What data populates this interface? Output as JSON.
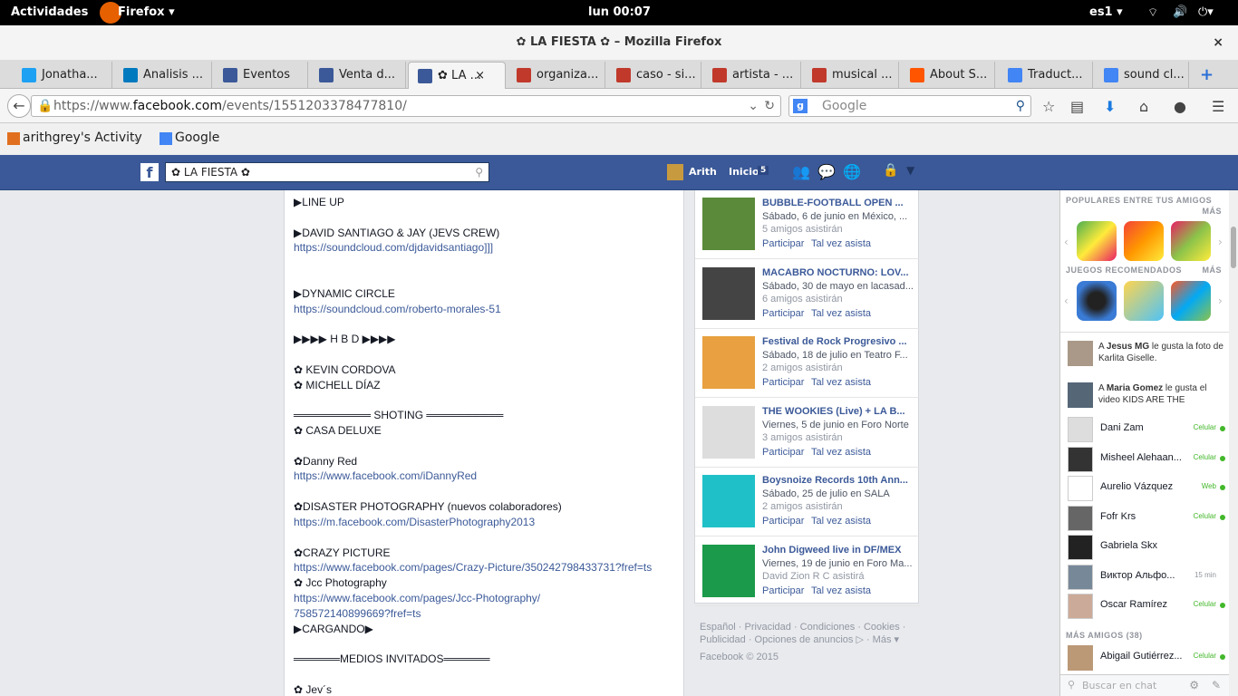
{
  "gnome": {
    "activities": "Actividades",
    "app": "Firefox ▾",
    "clock": "lun 00:07",
    "lang": "es1 ▾"
  },
  "window": {
    "title": "✿ LA FIESTA ✿ – Mozilla Firefox",
    "close": "×"
  },
  "tabs": [
    {
      "label": "Jonatha...",
      "icon": "twitter-icon",
      "color": "#1da1f2"
    },
    {
      "label": "Analisis ...",
      "icon": "trello-icon",
      "color": "#0079bf"
    },
    {
      "label": "Eventos",
      "icon": "facebook-icon",
      "color": "#3b5998"
    },
    {
      "label": "Venta d...",
      "icon": "facebook-icon",
      "color": "#3b5998"
    },
    {
      "label": "✿ LA ...",
      "icon": "facebook-icon",
      "color": "#3b5998"
    },
    {
      "label": "organiza...",
      "icon": "wordreference-icon",
      "color": "#c0392b"
    },
    {
      "label": "caso - si...",
      "icon": "wordreference-icon",
      "color": "#c0392b"
    },
    {
      "label": "artista - ...",
      "icon": "wordreference-icon",
      "color": "#c0392b"
    },
    {
      "label": "musical ...",
      "icon": "wordreference-icon",
      "color": "#c0392b"
    },
    {
      "label": "About S...",
      "icon": "soundcloud-icon",
      "color": "#ff5500"
    },
    {
      "label": "Traduct...",
      "icon": "translate-icon",
      "color": "#4285f4"
    },
    {
      "label": "sound cl...",
      "icon": "google-icon",
      "color": "#4285f4"
    }
  ],
  "nav": {
    "url_prefix": "https://www.",
    "url_domain": "facebook.com",
    "url_path": "/events/1551203378477810/",
    "search_placeholder": "Google"
  },
  "bookmarks": [
    {
      "label": "arithgrey's Activity"
    },
    {
      "label": "Google"
    }
  ],
  "fb": {
    "search_value": "✿ LA FIESTA ✿",
    "user": "Arith",
    "home": "Inicio",
    "home_count": "5"
  },
  "post": {
    "lines": [
      {
        "text": "▶LINE UP",
        "link": false
      },
      {
        "text": "▶DAVID SANTIAGO & JAY (JEVS CREW)",
        "link": false
      },
      {
        "text": "https://soundcloud.com/djdavidsantiago]]]",
        "link": true
      },
      {
        "text": "▶DYNAMIC CIRCLE",
        "link": false
      },
      {
        "text": "https://soundcloud.com/roberto-morales-51",
        "link": true
      },
      {
        "text": "▶▶▶▶ H B D ▶▶▶▶",
        "link": false
      },
      {
        "text": "✿ KEVIN CORDOVA",
        "link": false
      },
      {
        "text": "✿ MICHELL DÍAZ",
        "link": false
      },
      {
        "text": "══════════ SHOTING ══════════",
        "link": false
      },
      {
        "text": "✿ CASA DELUXE",
        "link": false
      },
      {
        "text": "✿Danny Red",
        "link": false
      },
      {
        "text": "https://www.facebook.com/iDannyRed",
        "link": true
      },
      {
        "text": "✿DISASTER PHOTOGRAPHY (nuevos colaboradores)",
        "link": false
      },
      {
        "text": "https://m.facebook.com/DisasterPhotography2013",
        "link": true
      },
      {
        "text": "✿CRAZY PICTURE",
        "link": false
      },
      {
        "text": "https://www.facebook.com/pages/Crazy-Picture/350242798433731?fref=ts",
        "link": true
      },
      {
        "text": "✿ Jcc Photography",
        "link": false
      },
      {
        "text": "https://www.facebook.com/pages/Jcc-Photography/",
        "link": true
      },
      {
        "text": "758572140899669?fref=ts",
        "link": true
      },
      {
        "text": "▶CARGANDO▶",
        "link": false
      },
      {
        "text": "══════MEDIOS INVITADOS══════",
        "link": false
      },
      {
        "text": "✿ Jev´s",
        "link": false
      }
    ]
  },
  "events": [
    {
      "title": "BUBBLE-FOOTBALL OPEN ...",
      "date": "Sábado, 6 de junio en México, ...",
      "friends": "5 amigos asistirán",
      "thumb": "#5a8a3a"
    },
    {
      "title": "MACABRO NOCTURNO: LOV...",
      "date": "Sábado, 30 de mayo en lacasad...",
      "friends": "6 amigos asistirán",
      "thumb": "#444444"
    },
    {
      "title": "Festival de Rock Progresivo ...",
      "date": "Sábado, 18 de julio en Teatro F...",
      "friends": "2 amigos asistirán",
      "thumb": "#e8a040"
    },
    {
      "title": "THE WOOKIES (Live) + LA B...",
      "date": "Viernes, 5 de junio en Foro Norte",
      "friends": "3 amigos asistirán",
      "thumb": "#dddddd"
    },
    {
      "title": "Boysnoize Records 10th Ann...",
      "date": "Sábado, 25 de julio en SALA",
      "friends": "2 amigos asistirán",
      "thumb": "#20c0c8"
    },
    {
      "title": "John Digweed live in DF/MEX",
      "date": "Viernes, 19 de junio en Foro Ma...",
      "friends": "David Zion R C asistirá",
      "thumb": "#1a9a4a"
    }
  ],
  "event_actions": {
    "join": "Participar",
    "maybe": "Tal vez asista"
  },
  "footer": {
    "line1": "Español · Privacidad · Condiciones · Cookies ·",
    "line2": "Publicidad · Opciones de anuncios ▷ · Más ▾",
    "line3": "Facebook © 2015"
  },
  "chat": {
    "popular": "POPULARES ENTRE TUS AMIGOS",
    "more": "MÁS",
    "recommended": "JUEGOS RECOMENDADOS",
    "more2": "MÁS",
    "feed": [
      {
        "pre": "A ",
        "name": "Jesus MG",
        "post": " le gusta la foto de Karlita Giselle."
      },
      {
        "pre": "A ",
        "name": "Maria Gomez",
        "post": " le gusta el video KIDS ARE THE"
      }
    ],
    "friends": [
      {
        "name": "Dani Zam",
        "status": "Celular"
      },
      {
        "name": "Misheel Alehaan...",
        "status": "Celular"
      },
      {
        "name": "Aurelio Vázquez",
        "status": "Web"
      },
      {
        "name": "Fofr Krs",
        "status": "Celular"
      },
      {
        "name": "Gabriela Skx",
        "status": ""
      },
      {
        "name": "Виктор Альфо...",
        "status": "15 min"
      },
      {
        "name": "Oscar Ramírez",
        "status": "Celular"
      }
    ],
    "more_friends": "MÁS AMIGOS (38)",
    "last_friend": {
      "name": "Abigail Gutiérrez...",
      "status": "Celular"
    },
    "search_placeholder": "Buscar en chat"
  }
}
